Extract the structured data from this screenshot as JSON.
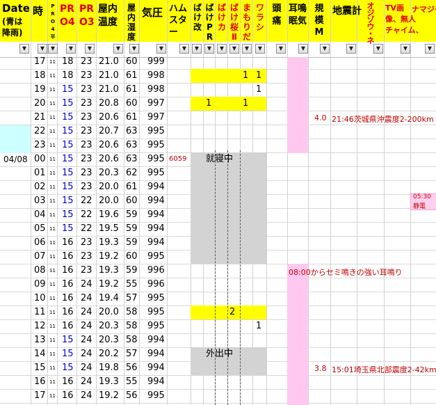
{
  "header": {
    "date": "Date",
    "date_sub1": "(青は",
    "date_sub2": "降雨)",
    "hour": "時",
    "pro4": [
      "P",
      "R",
      "O",
      "4",
      "平"
    ],
    "pr04": [
      "PR",
      "O4"
    ],
    "pr03": [
      "PR",
      "O3"
    ],
    "indoor_temp": [
      "屋内",
      "温度"
    ],
    "indoor_humidity": [
      "屋内",
      "湿度"
    ],
    "pressure": "気圧",
    "hamster": [
      "ハム",
      "スタ",
      "ー"
    ],
    "bake_kai": [
      "ば",
      "け",
      "改"
    ],
    "bake_pr": [
      "ば",
      "け",
      "P",
      "R"
    ],
    "bake_ca": [
      "ば",
      "け",
      "カ"
    ],
    "bake_sakura": [
      "ば",
      "け",
      "桜",
      "Ⅱ"
    ],
    "mamorida": [
      "ま",
      "も",
      "り",
      "だ"
    ],
    "warashi": [
      "ワ",
      "ラ",
      "シ"
    ],
    "headache": [
      "頭",
      "痛"
    ],
    "tinnitus": [
      "耳鳴",
      "眠気"
    ],
    "scale": [
      "規",
      "模",
      "M"
    ],
    "earthquake": "地震計",
    "ojizou": [
      "オ",
      "ジ",
      "ゾ",
      "ウ",
      "・",
      "ネ"
    ],
    "tv": [
      "TV画",
      "像、無人",
      "チャイム、"
    ],
    "namazu": "ナマジー"
  },
  "filter_glyph": "▼",
  "rows": [
    {
      "date": "",
      "hour": "17",
      "pro4": "11",
      "pr04": "18",
      "pr03": "23",
      "temp": "21.0",
      "hum": "60",
      "press": "999"
    },
    {
      "date": "",
      "hour": "18",
      "pro4": "11",
      "pr04": "18",
      "pr03": "23",
      "temp": "21.0",
      "hum": "61",
      "press": "998"
    },
    {
      "date": "",
      "hour": "19",
      "pro4": "11",
      "pr04": "15",
      "pr03": "23",
      "temp": "21.0",
      "hum": "61",
      "press": "998"
    },
    {
      "date": "",
      "hour": "20",
      "pro4": "11",
      "pr04": "15",
      "pr03": "23",
      "temp": "20.8",
      "hum": "60",
      "press": "997"
    },
    {
      "date": "",
      "hour": "21",
      "pro4": "11",
      "pr04": "15",
      "pr03": "23",
      "temp": "20.6",
      "hum": "61",
      "press": "997"
    },
    {
      "date": "",
      "hour": "22",
      "pro4": "11",
      "pr04": "15",
      "pr03": "23",
      "temp": "20.7",
      "hum": "63",
      "press": "995"
    },
    {
      "date": "",
      "hour": "23",
      "pro4": "11",
      "pr04": "15",
      "pr03": "23",
      "temp": "20.6",
      "hum": "63",
      "press": "995"
    },
    {
      "date": "04/08",
      "hour": "00",
      "pro4": "11",
      "pr04": "15",
      "pr03": "23",
      "temp": "20.6",
      "hum": "63",
      "press": "995"
    },
    {
      "date": "",
      "hour": "01",
      "pro4": "11",
      "pr04": "15",
      "pr03": "23",
      "temp": "20.3",
      "hum": "62",
      "press": "995"
    },
    {
      "date": "",
      "hour": "02",
      "pro4": "11",
      "pr04": "15",
      "pr03": "23",
      "temp": "20.0",
      "hum": "61",
      "press": "994"
    },
    {
      "date": "",
      "hour": "03",
      "pro4": "11",
      "pr04": "15",
      "pr03": "22",
      "temp": "20.0",
      "hum": "60",
      "press": "994"
    },
    {
      "date": "",
      "hour": "04",
      "pro4": "11",
      "pr04": "15",
      "pr03": "22",
      "temp": "19.6",
      "hum": "59",
      "press": "994"
    },
    {
      "date": "",
      "hour": "05",
      "pro4": "11",
      "pr04": "15",
      "pr03": "22",
      "temp": "19.5",
      "hum": "59",
      "press": "994"
    },
    {
      "date": "",
      "hour": "06",
      "pro4": "11",
      "pr04": "16",
      "pr03": "23",
      "temp": "19.3",
      "hum": "59",
      "press": "994"
    },
    {
      "date": "",
      "hour": "07",
      "pro4": "11",
      "pr04": "16",
      "pr03": "23",
      "temp": "19.2",
      "hum": "60",
      "press": "995"
    },
    {
      "date": "",
      "hour": "08",
      "pro4": "11",
      "pr04": "16",
      "pr03": "23",
      "temp": "19.3",
      "hum": "59",
      "press": "996"
    },
    {
      "date": "",
      "hour": "09",
      "pro4": "11",
      "pr04": "16",
      "pr03": "24",
      "temp": "19.2",
      "hum": "55",
      "press": "996"
    },
    {
      "date": "",
      "hour": "10",
      "pro4": "11",
      "pr04": "16",
      "pr03": "24",
      "temp": "19.4",
      "hum": "57",
      "press": "995"
    },
    {
      "date": "",
      "hour": "11",
      "pro4": "11",
      "pr04": "16",
      "pr03": "24",
      "temp": "20.0",
      "hum": "58",
      "press": "995"
    },
    {
      "date": "",
      "hour": "12",
      "pro4": "11",
      "pr04": "16",
      "pr03": "24",
      "temp": "20.3",
      "hum": "58",
      "press": "995"
    },
    {
      "date": "",
      "hour": "13",
      "pro4": "11",
      "pr04": "15",
      "pr03": "24",
      "temp": "20.3",
      "hum": "58",
      "press": "994"
    },
    {
      "date": "",
      "hour": "14",
      "pro4": "11",
      "pr04": "15",
      "pr03": "24",
      "temp": "20.2",
      "hum": "57",
      "press": "994"
    },
    {
      "date": "",
      "hour": "15",
      "pro4": "11",
      "pr04": "15",
      "pr03": "24",
      "temp": "19.8",
      "hum": "56",
      "press": "994"
    },
    {
      "date": "",
      "hour": "16",
      "pro4": "11",
      "pr04": "16",
      "pr03": "24",
      "temp": "19.3",
      "hum": "55",
      "press": "994"
    },
    {
      "date": "",
      "hour": "17",
      "pro4": "11",
      "pr04": "16",
      "pr03": "24",
      "temp": "19.2",
      "hum": "56",
      "press": "995"
    }
  ],
  "hamster_value": "6059",
  "sleeping_label": "就寝中",
  "outing_label": "外出中",
  "bake_values": {
    "row18_mamorida": "1",
    "row18_warashi": "1",
    "row19_warashi": "1",
    "row20_kai": "1",
    "row20_mamorida": "1",
    "row11_ca": "2",
    "row12_warashi": "1"
  },
  "quake1": {
    "mag": "4.0",
    "text": "21:46茨城県沖震度2-200km"
  },
  "quake2": {
    "mag": "3.8",
    "text": "15:01埼玉県北部震度2-42km"
  },
  "tinnitus_note": "08:00からセミ鳴きの強い耳鳴り",
  "namazu_note_top": "05:30",
  "namazu_note_bottom": "静電"
}
